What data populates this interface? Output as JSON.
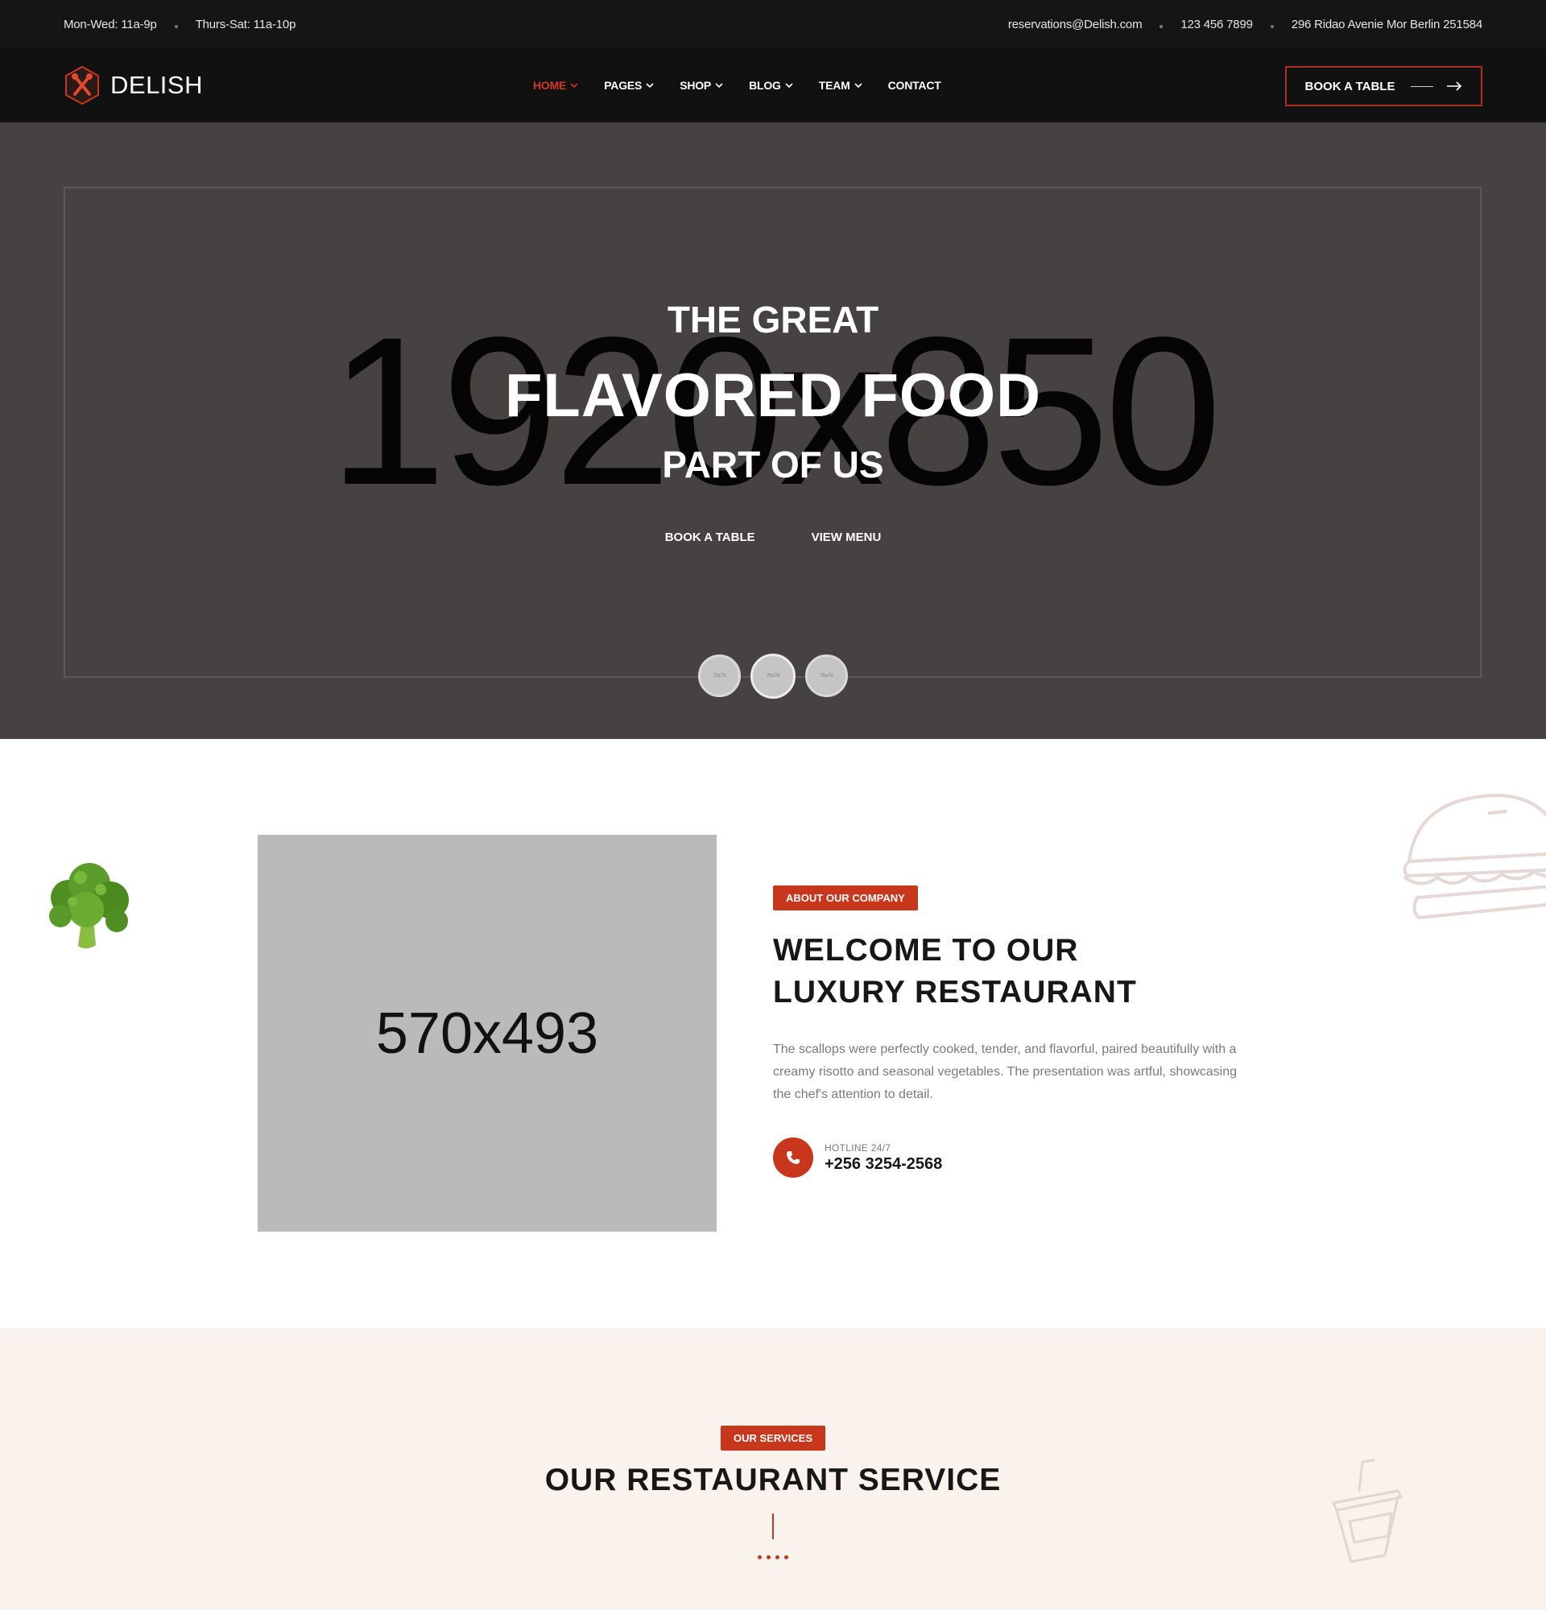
{
  "topbar": {
    "hours_1": "Mon-Wed: 11a-9p",
    "hours_2": "Thurs-Sat: 11a-10p",
    "email": "reservations@Delish.com",
    "phone": "123 456 7899",
    "address": "296 Ridao Avenie Mor Berlin 251584"
  },
  "header": {
    "logo_text": "DELISH",
    "nav": [
      {
        "label": "HOME",
        "active": true,
        "dropdown": true
      },
      {
        "label": "PAGES",
        "dropdown": true
      },
      {
        "label": "SHOP",
        "dropdown": true
      },
      {
        "label": "BLOG",
        "dropdown": true
      },
      {
        "label": "TEAM",
        "dropdown": true
      },
      {
        "label": "CONTACT",
        "dropdown": false
      }
    ],
    "cta_label": "BOOK A TABLE"
  },
  "hero": {
    "placeholder_text": "1920x850",
    "line_1": "THE GREAT",
    "line_2": "FLAVORED FOOD",
    "line_3": "PART OF US",
    "action_1": "BOOK A TABLE",
    "action_2": "VIEW MENU",
    "slider_dots": [
      {
        "label": "70x70"
      },
      {
        "label": "70x70",
        "active": true
      },
      {
        "label": "70x70"
      }
    ]
  },
  "about": {
    "image_placeholder": "570x493",
    "badge": "ABOUT OUR COMPANY",
    "title_line_1": "WELCOME TO OUR",
    "title_line_2": "LUXURY RESTAURANT",
    "text": "The scallops were perfectly cooked, tender, and flavorful, paired beautifully with a creamy risotto and seasonal vegetables. The presentation was artful, showcasing the chef's attention to detail.",
    "hotline_label": "HOTLINE 24/7",
    "hotline_number": "+256 3254-2568"
  },
  "services": {
    "badge": "OUR SERVICES",
    "title": "OUR RESTAURANT SERVICE"
  },
  "colors": {
    "accent": "#c8361b",
    "topbar_bg": "#151515",
    "header_bg": "#111111",
    "hero_bg": "#464242",
    "services_bg": "#faf2ed"
  },
  "icons": [
    "logo-icon",
    "chevron-down-icon",
    "arrow-right-icon",
    "phone-icon",
    "broccoli-icon",
    "burger-icon",
    "cup-icon"
  ]
}
